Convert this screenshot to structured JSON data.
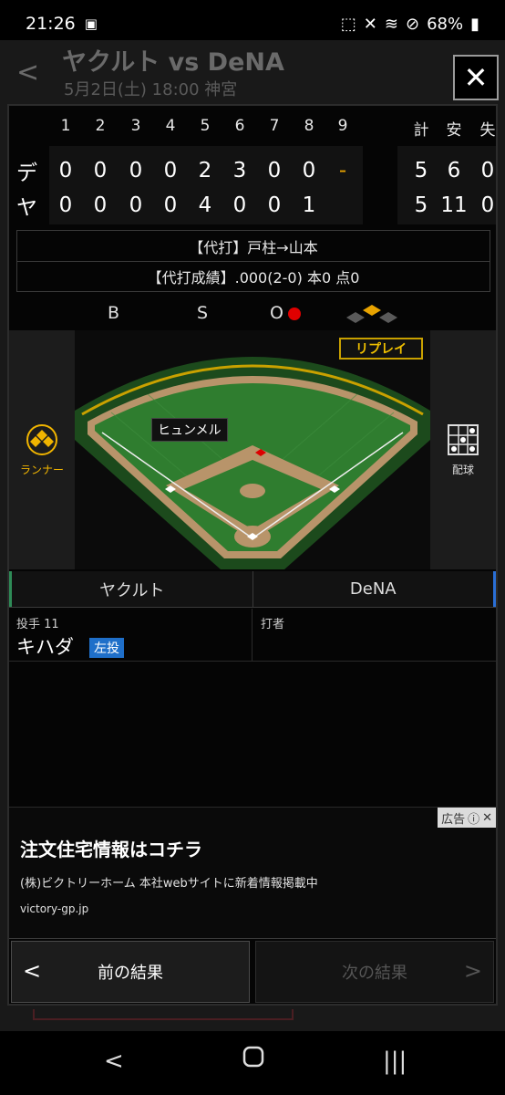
{
  "status_bar": {
    "time": "21:26",
    "battery": "68%",
    "icons": [
      "notification-icon",
      "lock-icon",
      "mute-icon",
      "wifi-icon",
      "block-icon",
      "battery-icon"
    ]
  },
  "background_page": {
    "title": "ヤクルト vs DeNA",
    "subtitle": "5月2日(土) 18:00 神宮"
  },
  "close_label": "✕",
  "scoreboard": {
    "innings": [
      "1",
      "2",
      "3",
      "4",
      "5",
      "6",
      "7",
      "8",
      "9"
    ],
    "totals_headers": [
      "計",
      "安",
      "失"
    ],
    "rows": [
      {
        "team": "デ",
        "scores": [
          "0",
          "0",
          "0",
          "0",
          "2",
          "3",
          "0",
          "0",
          "-"
        ],
        "totals": [
          "5",
          "6",
          "0"
        ]
      },
      {
        "team": "ヤ",
        "scores": [
          "0",
          "0",
          "0",
          "0",
          "4",
          "0",
          "0",
          "1",
          ""
        ],
        "totals": [
          "5",
          "11",
          "0"
        ]
      }
    ]
  },
  "pinch": {
    "line1": "【代打】戸柱→山本",
    "line2": "【代打成績】.000(2-0) 本0 点0"
  },
  "count": {
    "b_label": "B",
    "s_label": "S",
    "o_label": "O",
    "outs": 1
  },
  "field": {
    "replay_label": "リプレイ",
    "player_tag": "ヒュンメル",
    "runner_label": "ランナー",
    "pitch_label": "配球"
  },
  "teams": {
    "home": "ヤクルト",
    "away": "DeNA"
  },
  "pitcher": {
    "role": "投手 11",
    "name": "キハダ",
    "hand": "左投"
  },
  "batter": {
    "role": "打者"
  },
  "ad": {
    "tag": "広告",
    "title": "注文住宅情報はコチラ",
    "description": "(株)ビクトリーホーム 本社webサイトに新着情報掲載中",
    "url": "victory-gp.jp"
  },
  "nav": {
    "prev": "前の結果",
    "next": "次の結果"
  },
  "colors": {
    "accent_gold": "#f0c000",
    "out_red": "#e00000",
    "home_team": "#2e8b57",
    "away_team": "#2a6fd6",
    "badge_blue": "#1f6fc9"
  }
}
